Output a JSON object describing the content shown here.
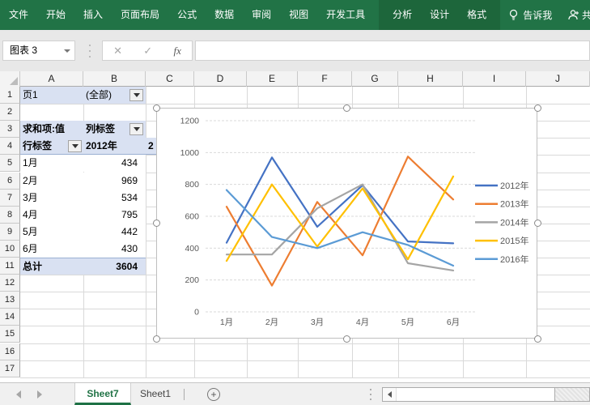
{
  "ribbon": {
    "tabs": [
      "文件",
      "开始",
      "插入",
      "页面布局",
      "公式",
      "数据",
      "审阅",
      "视图",
      "开发工具"
    ],
    "contextual_tabs": [
      "分析",
      "设计",
      "格式"
    ],
    "tell_me": "告诉我",
    "share": "共"
  },
  "formula_bar": {
    "name_box": "图表 3",
    "cancel_icon": "✕",
    "enter_icon": "✓",
    "fx_label": "fx",
    "value": ""
  },
  "grid": {
    "columns": [
      "A",
      "B",
      "C",
      "D",
      "E",
      "F",
      "G",
      "H",
      "I",
      "J"
    ],
    "rows": [
      "1",
      "2",
      "3",
      "4",
      "5",
      "6",
      "7",
      "8",
      "9",
      "10",
      "11",
      "12",
      "13",
      "14",
      "15",
      "16",
      "17"
    ]
  },
  "pivot": {
    "filter_label": "页1",
    "filter_value": "(全部)",
    "value_field_label": "求和项:值",
    "col_header_label": "列标签",
    "row_header_label": "行标签",
    "first_col_header": "2012年",
    "clipped_col_header": "2",
    "rows": [
      {
        "month": "1月",
        "value": "434"
      },
      {
        "month": "2月",
        "value": "969"
      },
      {
        "month": "3月",
        "value": "534"
      },
      {
        "month": "4月",
        "value": "795"
      },
      {
        "month": "5月",
        "value": "442"
      },
      {
        "month": "6月",
        "value": "430"
      }
    ],
    "total_label": "总计",
    "total_value": "3604"
  },
  "chart_data": {
    "type": "line",
    "categories": [
      "1月",
      "2月",
      "3月",
      "4月",
      "5月",
      "6月"
    ],
    "series": [
      {
        "name": "2012年",
        "color": "#4472C4",
        "values": [
          434,
          969,
          534,
          795,
          442,
          430
        ]
      },
      {
        "name": "2013年",
        "color": "#ED7D31",
        "values": [
          660,
          165,
          690,
          355,
          975,
          705
        ]
      },
      {
        "name": "2014年",
        "color": "#A5A5A5",
        "values": [
          360,
          360,
          650,
          800,
          305,
          260
        ]
      },
      {
        "name": "2015年",
        "color": "#FFC000",
        "values": [
          320,
          800,
          410,
          775,
          330,
          850
        ]
      },
      {
        "name": "2016年",
        "color": "#5B9BD5",
        "values": [
          765,
          470,
          400,
          500,
          420,
          290
        ]
      }
    ],
    "title": "",
    "xlabel": "",
    "ylabel": "",
    "ylim": [
      0,
      1200
    ],
    "yticks": [
      0,
      200,
      400,
      600,
      800,
      1000,
      1200
    ],
    "grid": true,
    "legend_position": "right"
  },
  "sheet_bar": {
    "tabs": [
      {
        "label": "Sheet7",
        "active": true
      },
      {
        "label": "Sheet1",
        "active": false
      }
    ],
    "add_label": "+"
  },
  "colors": {
    "ribbon_green": "#217346",
    "contextual_panel": "#1d663b",
    "pivot_fill": "#D9E1F2",
    "gridline": "#D9D9D9",
    "axis_text": "#595959",
    "active_sheet_green": "#217346"
  }
}
